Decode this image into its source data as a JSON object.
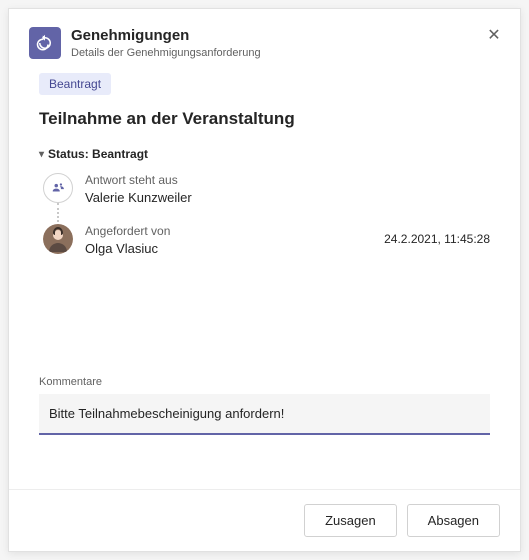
{
  "header": {
    "title": "Genehmigungen",
    "subtitle": "Details der Genehmigungsanforderung"
  },
  "status_badge": "Beantragt",
  "request_title": "Teilnahme an der Veranstaltung",
  "status_line": {
    "label": "Status:",
    "value": "Beantragt"
  },
  "timeline": [
    {
      "label": "Antwort steht aus",
      "name": "Valerie Kunzweiler",
      "timestamp": "",
      "icon": "pending"
    },
    {
      "label": "Angefordert von",
      "name": "Olga Vlasiuc",
      "timestamp": "24.2.2021, 11:45:28",
      "icon": "avatar"
    }
  ],
  "comments": {
    "label": "Kommentare",
    "value": "Bitte Teilnahmebescheinigung anfordern!"
  },
  "footer": {
    "approve": "Zusagen",
    "reject": "Absagen"
  }
}
